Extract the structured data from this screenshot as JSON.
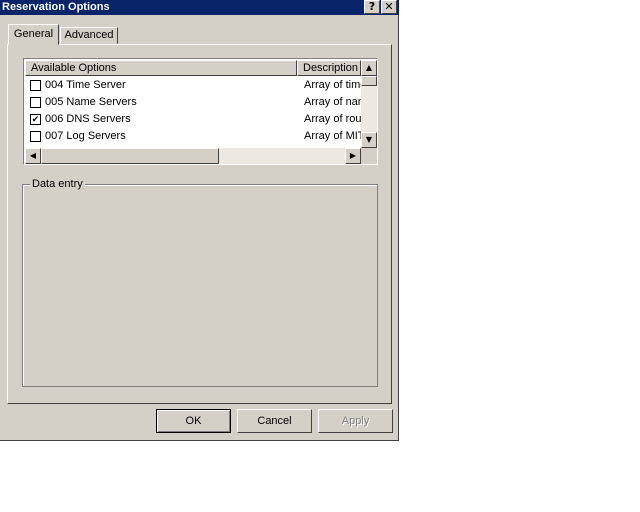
{
  "window": {
    "title": "Reservation Options",
    "help_glyph": "?",
    "close_glyph": "✕"
  },
  "tabs": [
    {
      "label": "General",
      "active": true
    },
    {
      "label": "Advanced",
      "active": false
    }
  ],
  "options_list": {
    "columns": [
      "Available Options",
      "Description"
    ],
    "rows": [
      {
        "label": "004 Time Server",
        "description": "Array of time",
        "checked": false
      },
      {
        "label": "005 Name Servers",
        "description": "Array of nam",
        "checked": false
      },
      {
        "label": "006 DNS Servers",
        "description": "Array of rout",
        "checked": true
      },
      {
        "label": "007 Log Servers",
        "description": "Array of MIT",
        "checked": false
      }
    ],
    "check_glyph": "✔",
    "scroll_up_glyph": "▲",
    "scroll_down_glyph": "▼",
    "scroll_left_glyph": "◀",
    "scroll_right_glyph": "▶"
  },
  "data_entry": {
    "label": "Data entry"
  },
  "buttons": {
    "ok": "OK",
    "cancel": "Cancel",
    "apply": "Apply",
    "apply_enabled": false
  },
  "colors": {
    "titlebar": "#0a246a",
    "face": "#d4d0c8"
  }
}
